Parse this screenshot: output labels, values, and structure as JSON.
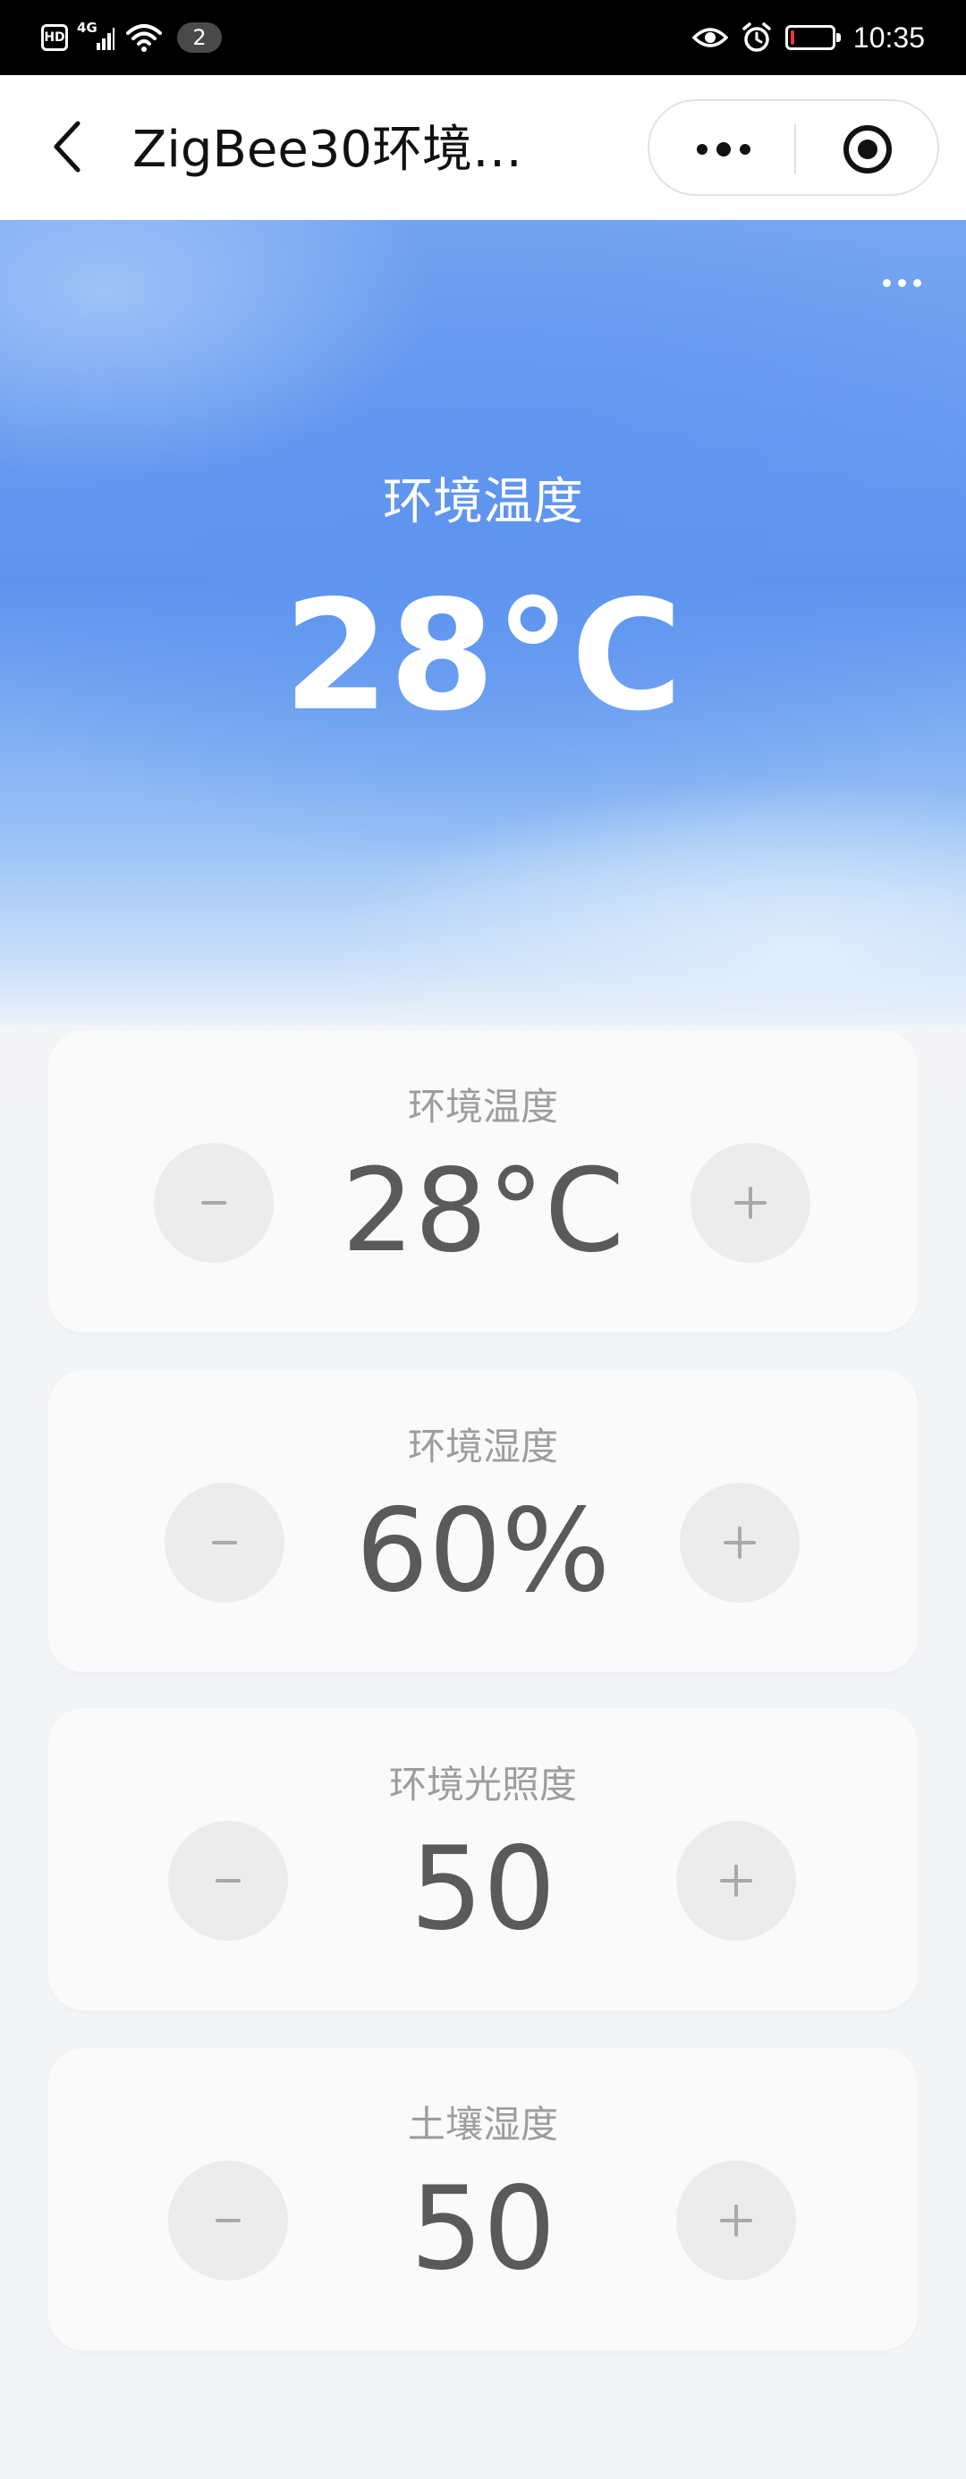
{
  "status_bar": {
    "hd_label": "HD",
    "network_label": "4G",
    "notification_count": "2",
    "time": "10:35",
    "battery_level": 0.08,
    "icons": [
      "hd-icon",
      "signal-icon",
      "wifi-icon",
      "eye-icon",
      "alarm-icon",
      "battery-icon"
    ]
  },
  "nav": {
    "title": "ZigBee30环境…",
    "icons": [
      "back-arrow-icon",
      "more-dots-icon",
      "target-icon"
    ]
  },
  "hero": {
    "label": "环境温度",
    "value": "28°C",
    "menu_icon": "more-dots-icon",
    "colors": {
      "top": "#76a6f2",
      "mid": "#5d94ee",
      "bottom": "#e4eefb"
    }
  },
  "cards": [
    {
      "label": "环境温度",
      "value": "28°C"
    },
    {
      "label": "环境湿度",
      "value": "60%"
    },
    {
      "label": "环境光照度",
      "value": "50"
    },
    {
      "label": "土壤湿度",
      "value": "50"
    }
  ],
  "colors": {
    "page_background": "#f4f5f7",
    "card_background": "#fafafa",
    "button_background": "#ececec",
    "value_text": "#5a5a5a",
    "label_text": "#9d9d9d"
  }
}
